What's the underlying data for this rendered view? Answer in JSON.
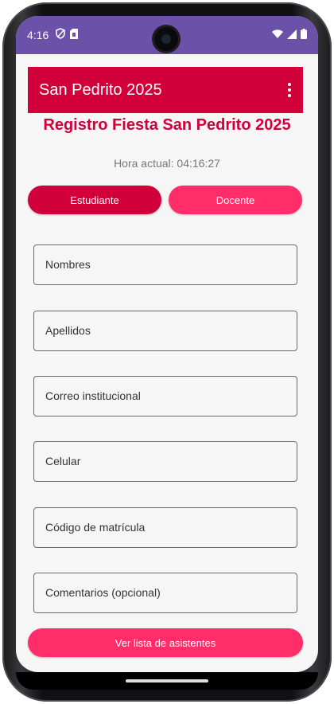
{
  "status_bar": {
    "time": "4:16",
    "left_icons": [
      "shield-icon",
      "sim-card-icon"
    ],
    "right_icons": [
      "wifi-icon",
      "signal-icon",
      "battery-icon"
    ],
    "background": "#6b52a8"
  },
  "app_bar": {
    "title": "San Pedrito 2025",
    "background": "#d1003a"
  },
  "main": {
    "heading": "Registro Fiesta San Pedrito 2025",
    "current_time": "Hora actual: 04:16:27",
    "toggle": {
      "student_label": "Estudiante",
      "teacher_label": "Docente",
      "selected": "Estudiante"
    },
    "fields": [
      {
        "label": "Nombres"
      },
      {
        "label": "Apellidos"
      },
      {
        "label": "Correo institucional"
      },
      {
        "label": "Celular"
      },
      {
        "label": "Código de matrícula"
      },
      {
        "label": "Comentarios (opcional)"
      }
    ],
    "list_button_label": "Ver lista de asistentes"
  },
  "colors": {
    "primary": "#d1003a",
    "accent": "#ff2d6a"
  }
}
